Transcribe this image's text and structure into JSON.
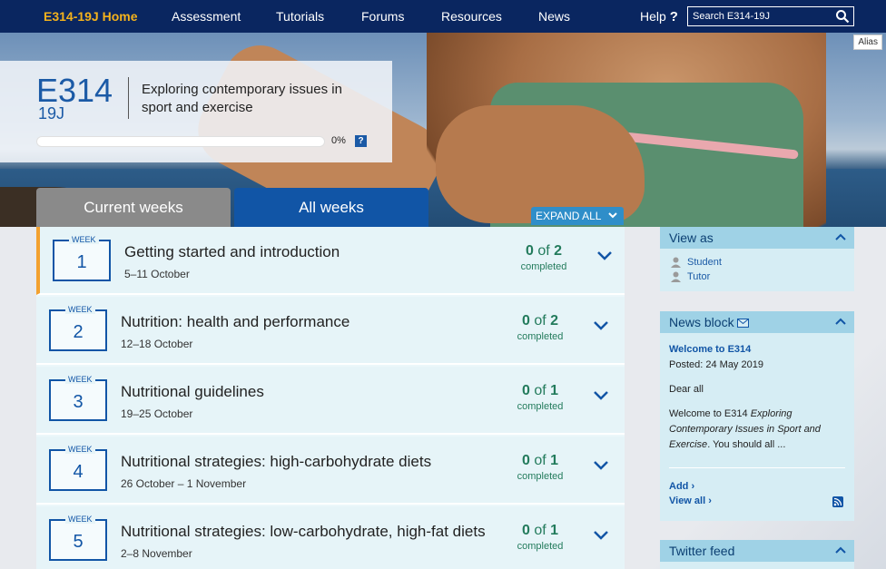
{
  "nav": {
    "home": "E314-19J Home",
    "items": [
      "Assessment",
      "Tutorials",
      "Forums",
      "Resources",
      "News"
    ],
    "help": "Help",
    "search_placeholder": "Search E314-19J"
  },
  "hero": {
    "alias": "Alias",
    "course_code": "E314",
    "course_sub": "19J",
    "course_title": "Exploring contemporary issues in sport and exercise",
    "progress": 0,
    "progress_label": "0%",
    "help_badge": "?"
  },
  "tabs": {
    "current": "Current weeks",
    "all": "All weeks",
    "expand_all": "EXPAND ALL"
  },
  "weeks": [
    {
      "label": "WEEK",
      "number": "1",
      "title": "Getting started and introduction",
      "dates": "5–11 October",
      "done": "0",
      "of": "of",
      "total": "2",
      "completed": "completed"
    },
    {
      "label": "WEEK",
      "number": "2",
      "title": "Nutrition: health and performance",
      "dates": "12–18 October",
      "done": "0",
      "of": "of",
      "total": "2",
      "completed": "completed"
    },
    {
      "label": "WEEK",
      "number": "3",
      "title": "Nutritional guidelines",
      "dates": "19–25 October",
      "done": "0",
      "of": "of",
      "total": "1",
      "completed": "completed"
    },
    {
      "label": "WEEK",
      "number": "4",
      "title": "Nutritional strategies: high-carbohydrate diets",
      "dates": "26 October – 1 November",
      "done": "0",
      "of": "of",
      "total": "1",
      "completed": "completed"
    },
    {
      "label": "WEEK",
      "number": "5",
      "title": "Nutritional strategies: low-carbohydrate, high-fat diets",
      "dates": "2–8 November",
      "done": "0",
      "of": "of",
      "total": "1",
      "completed": "completed"
    }
  ],
  "sidebar": {
    "view_as": {
      "title": "View as",
      "student": "Student",
      "tutor": "Tutor"
    },
    "news": {
      "title": "News block",
      "heading": "Welcome to E314",
      "posted": "Posted: 24 May 2019",
      "dear": "Dear all",
      "body_start": "Welcome to E314 ",
      "body_italic": "Exploring Contemporary Issues in Sport and Exercise",
      "body_end": ".   You should all ...",
      "add": "Add",
      "view_all": "View all"
    },
    "twitter": {
      "title": "Twitter feed"
    }
  }
}
